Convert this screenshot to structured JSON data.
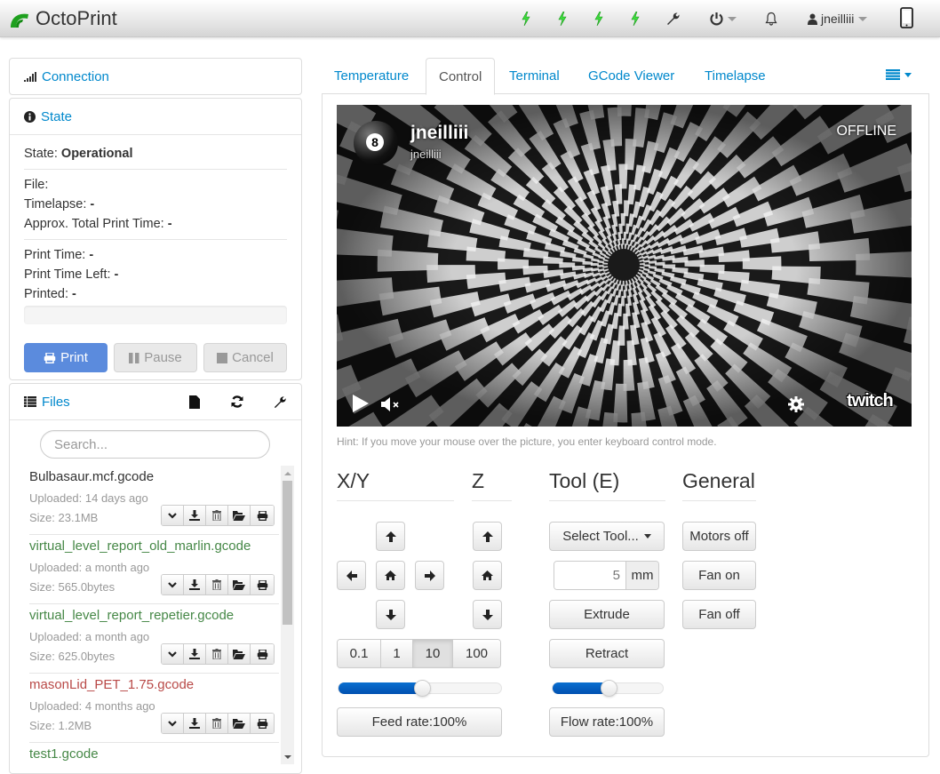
{
  "navbar": {
    "brand": "OctoPrint",
    "colors": {
      "brand_green": "#1ea01e",
      "bolt_green": "#3ddc3d",
      "link_blue": "#0088cc"
    },
    "status_icons": [
      "lightning-icon",
      "lightning-icon",
      "lightning-icon",
      "lightning-icon"
    ],
    "settings_icon": "wrench-icon",
    "system_icon": "power-icon",
    "notifications_icon": "bell-icon",
    "user": {
      "icon": "user-icon",
      "name": "jneilliii"
    },
    "mobile_icon": "mobile-phone-icon"
  },
  "sidebar": {
    "connection": {
      "icon": "signal-icon",
      "title": "Connection"
    },
    "state": {
      "icon": "info-circle-icon",
      "title": "State",
      "state_label": "State:",
      "state_value": "Operational",
      "file_label": "File:",
      "file_value": "",
      "timelapse_label": "Timelapse:",
      "timelapse_value": "-",
      "approx_label": "Approx. Total Print Time:",
      "approx_value": "-",
      "print_time_label": "Print Time:",
      "print_time_value": "-",
      "time_left_label": "Print Time Left:",
      "time_left_value": "-",
      "printed_label": "Printed:",
      "printed_value": "-",
      "progress_percent": 0,
      "buttons": {
        "print": "Print",
        "pause": "Pause",
        "cancel": "Cancel"
      }
    },
    "files": {
      "icon": "list-icon",
      "title": "Files",
      "tools": [
        "new-file-icon",
        "refresh-icon",
        "wrench-icon"
      ],
      "search_placeholder": "Search...",
      "items": [
        {
          "name": "Bulbasaur.mcf.gcode",
          "status": "default",
          "color": "#333333",
          "uploaded": "Uploaded: 14 days ago",
          "size": "Size: 23.1MB"
        },
        {
          "name": "virtual_level_report_old_marlin.gcode",
          "status": "success",
          "color": "#468847",
          "uploaded": "Uploaded: a month ago",
          "size": "Size: 565.0bytes"
        },
        {
          "name": "virtual_level_report_repetier.gcode",
          "status": "success",
          "color": "#468847",
          "uploaded": "Uploaded: a month ago",
          "size": "Size: 625.0bytes"
        },
        {
          "name": "masonLid_PET_1.75.gcode",
          "status": "failed",
          "color": "#b94a48",
          "uploaded": "Uploaded: 4 months ago",
          "size": "Size: 1.2MB"
        },
        {
          "name": "test1.gcode",
          "status": "success",
          "color": "#468847",
          "uploaded": "",
          "size": ""
        }
      ],
      "item_actions": [
        "chevron-down-icon",
        "download-icon",
        "trash-icon",
        "folder-open-icon",
        "print-icon"
      ]
    }
  },
  "tabs": {
    "items": [
      {
        "label": "Temperature",
        "active": false
      },
      {
        "label": "Control",
        "active": true
      },
      {
        "label": "Terminal",
        "active": false
      },
      {
        "label": "GCode Viewer",
        "active": false
      },
      {
        "label": "Timelapse",
        "active": false
      }
    ],
    "menu_icon": "list-icon"
  },
  "webcam": {
    "channel_name": "jneilliii",
    "channel_sub": "jneilliii",
    "status": "OFFLINE",
    "avatar_number": "8",
    "controls": [
      "play-icon",
      "mute-icon",
      "gear-icon",
      "twitch-logo"
    ],
    "twitch_label": "twitch",
    "hint": "Hint: If you move your mouse over the picture, you enter keyboard control mode."
  },
  "control": {
    "xy": {
      "title": "X/Y"
    },
    "z": {
      "title": "Z"
    },
    "tool": {
      "title": "Tool (E)",
      "select_label": "Select Tool...",
      "amount_value": "5",
      "amount_unit": "mm",
      "extrude": "Extrude",
      "retract": "Retract",
      "flow_rate_label": "Flow rate:100%",
      "flow_rate_percent": 100,
      "flow_slider_fraction": 0.52
    },
    "general": {
      "title": "General",
      "motors_off": "Motors off",
      "fan_on": "Fan on",
      "fan_off": "Fan off"
    },
    "increments": [
      {
        "label": "0.1",
        "active": false
      },
      {
        "label": "1",
        "active": false
      },
      {
        "label": "10",
        "active": true
      },
      {
        "label": "100",
        "active": false
      }
    ],
    "feed_rate_label": "Feed rate:100%",
    "feed_rate_percent": 100,
    "feed_slider_fraction": 0.52
  }
}
